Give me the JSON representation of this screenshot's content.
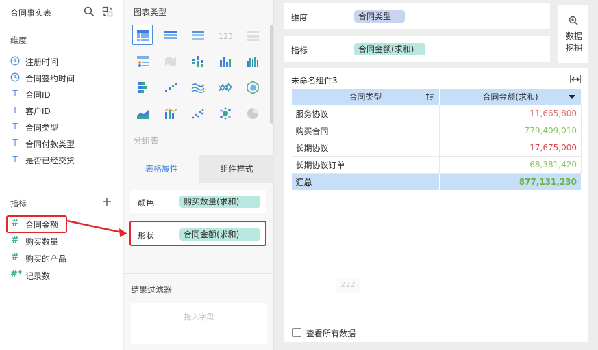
{
  "left_panel": {
    "table_title": "合同事实表",
    "dimension_title": "维度",
    "dimensions": [
      {
        "label": "注册时间",
        "icon": "clock-icon"
      },
      {
        "label": "合同签约时间",
        "icon": "clock-icon"
      },
      {
        "label": "合同ID",
        "icon": "text-type-icon"
      },
      {
        "label": "客户ID",
        "icon": "text-type-icon"
      },
      {
        "label": "合同类型",
        "icon": "text-type-icon"
      },
      {
        "label": "合同付款类型",
        "icon": "text-type-icon"
      },
      {
        "label": "是否已经交货",
        "icon": "text-type-icon"
      }
    ],
    "measure_title": "指标",
    "measures": [
      {
        "label": "合同金额",
        "icon": "number-type-icon",
        "glyph": "#"
      },
      {
        "label": "购买数量",
        "icon": "number-type-icon",
        "glyph": "#"
      },
      {
        "label": "购买的产品",
        "icon": "number-type-icon",
        "glyph": "#"
      },
      {
        "label": "记录数",
        "icon": "count-type-icon",
        "glyph": "#*"
      }
    ]
  },
  "middle_panel": {
    "chart_type_title": "图表类型",
    "group_table_label": "分组表",
    "tabs": [
      {
        "label": "表格属性",
        "active": true
      },
      {
        "label": "组件样式",
        "active": false
      }
    ],
    "props": {
      "color_label": "颜色",
      "color_field": "购买数量(求和)",
      "shape_label": "形状",
      "shape_field": "合同金额(求和)"
    },
    "filter_title": "结果过滤器",
    "drop_hint": "拖入字段"
  },
  "right_area": {
    "dimension_shelf_label": "维度",
    "dimension_shelf_field": "合同类型",
    "measure_shelf_label": "指标",
    "measure_shelf_field": "合同金额(求和)",
    "mining_label": "数据挖掘",
    "widget_title": "未命名组件3",
    "columns": [
      "合同类型",
      "合同金额(求和)"
    ],
    "rows": [
      {
        "type": "服务协议",
        "amount": "11,665,800",
        "color": "#e06a6a"
      },
      {
        "type": "购买合同",
        "amount": "779,409,010",
        "color": "#8cc36a"
      },
      {
        "type": "长期协议",
        "amount": "17,675,000",
        "color": "#e0474f"
      },
      {
        "type": "长期协议订单",
        "amount": "68,381,420",
        "color": "#8cc36a"
      }
    ],
    "total": {
      "label": "汇总",
      "amount": "877,131,230",
      "color": "#6cb33f"
    },
    "ghost_value": "222",
    "view_all_label": "查看所有数据"
  },
  "colors": {
    "accent": "#3d7fe0",
    "highlight": "#e0282e",
    "header_bg": "#c6def7",
    "measure_pill": "#b8e8e0",
    "dimension_pill": "#c8d4f0"
  }
}
